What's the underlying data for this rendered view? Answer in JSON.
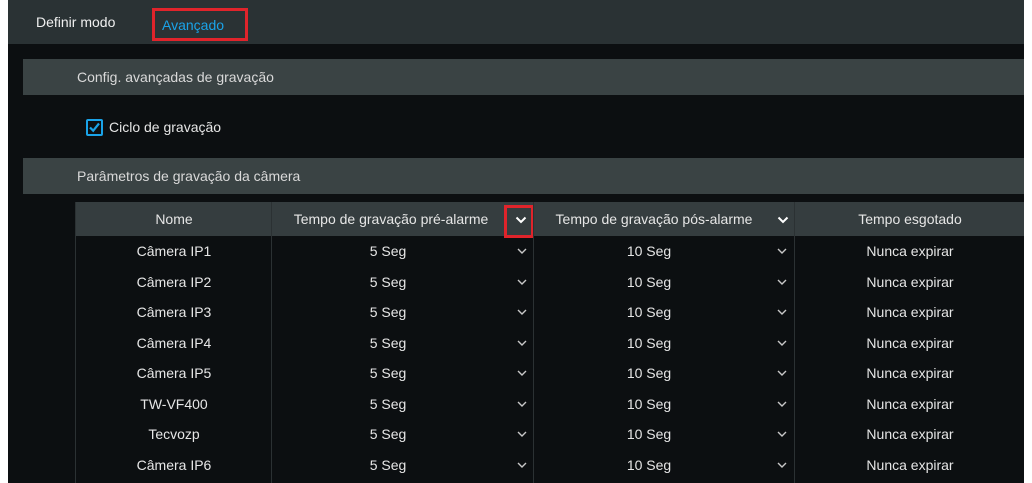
{
  "tabs": {
    "mode_label": "Definir modo",
    "advanced_label": "Avançado"
  },
  "sections": {
    "advanced_record": "Config. avançadas de gravação",
    "camera_params": "Parâmetros de gravação da câmera"
  },
  "cycle_record": {
    "label": "Ciclo de gravação",
    "checked": true
  },
  "table": {
    "headers": {
      "name": "Nome",
      "pre_alarm": "Tempo de gravação pré-alarme",
      "post_alarm": "Tempo de gravação pós-alarme",
      "expire": "Tempo esgotado"
    },
    "rows": [
      {
        "name": "Câmera IP1",
        "pre": "5 Seg",
        "post": "10 Seg",
        "expire": "Nunca expirar"
      },
      {
        "name": "Câmera IP2",
        "pre": "5 Seg",
        "post": "10 Seg",
        "expire": "Nunca expirar"
      },
      {
        "name": "Câmera IP3",
        "pre": "5 Seg",
        "post": "10 Seg",
        "expire": "Nunca expirar"
      },
      {
        "name": "Câmera IP4",
        "pre": "5 Seg",
        "post": "10 Seg",
        "expire": "Nunca expirar"
      },
      {
        "name": "Câmera IP5",
        "pre": "5 Seg",
        "post": "10 Seg",
        "expire": "Nunca expirar"
      },
      {
        "name": "TW-VF400",
        "pre": "5 Seg",
        "post": "10 Seg",
        "expire": "Nunca expirar"
      },
      {
        "name": "Tecvozp",
        "pre": "5 Seg",
        "post": "10 Seg",
        "expire": "Nunca expirar"
      },
      {
        "name": "Câmera IP6",
        "pre": "5 Seg",
        "post": "10 Seg",
        "expire": "Nunca expirar"
      }
    ]
  },
  "colors": {
    "accent": "#1aa3e8",
    "highlight": "#e0242b"
  }
}
